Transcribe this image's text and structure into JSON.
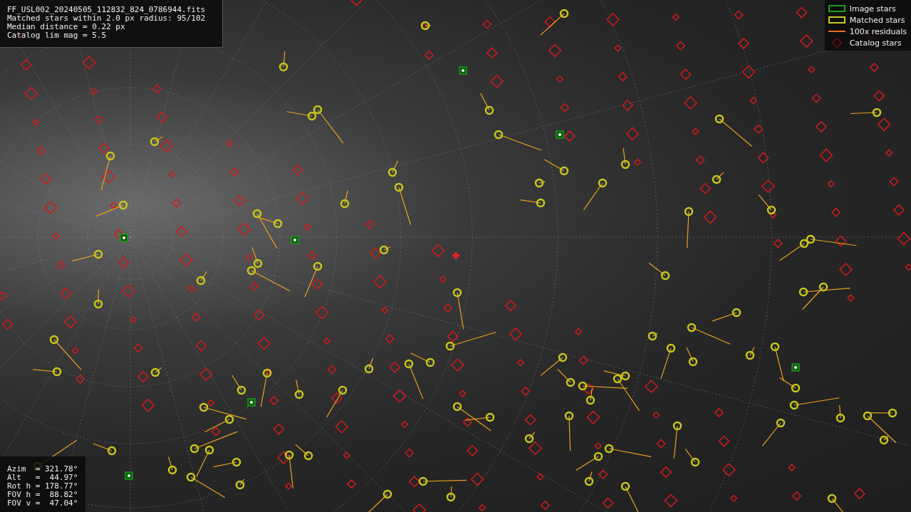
{
  "file_info": {
    "lines": [
      "FF_USL002_20240505_112832_824_0786944.fits",
      "Matched stars within 2.0 px radius: 95/102",
      "Median distance = 0.22 px",
      "Catalog lim mag = 5.5"
    ]
  },
  "legend": [
    {
      "kind": "image",
      "label": "Image stars"
    },
    {
      "kind": "matched",
      "label": "Matched stars"
    },
    {
      "kind": "residual",
      "label": "100x residuals"
    },
    {
      "kind": "catalog",
      "label": "Catalog stars"
    }
  ],
  "pointing": {
    "lines": [
      "Azim  = 321.78°",
      "Alt   =  44.97°",
      "Rot h = 178.77°",
      "FOV h =  88.82°",
      "FOV v =  47.04°"
    ]
  }
}
